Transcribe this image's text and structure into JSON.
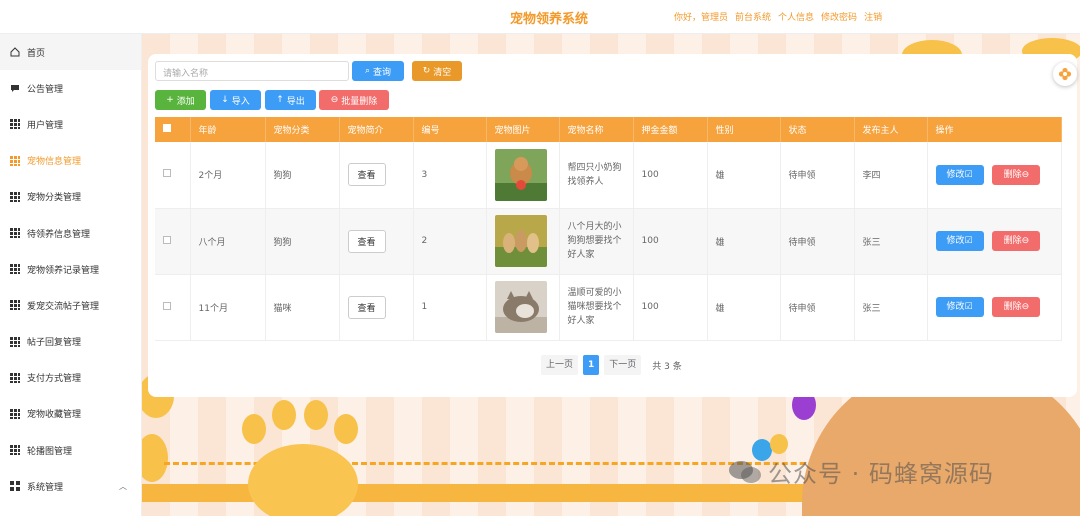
{
  "header": {
    "title": "宠物领养系统",
    "links": [
      "你好，管理员",
      "前台系统",
      "个人信息",
      "修改密码",
      "注销"
    ]
  },
  "sidebar": {
    "items": [
      {
        "label": "首页",
        "icon": "home-icon"
      },
      {
        "label": "公告管理",
        "icon": "message-icon"
      },
      {
        "label": "用户管理",
        "icon": "grid-icon"
      },
      {
        "label": "宠物信息管理",
        "icon": "grid-icon"
      },
      {
        "label": "宠物分类管理",
        "icon": "grid-icon"
      },
      {
        "label": "待领养信息管理",
        "icon": "grid-icon"
      },
      {
        "label": "宠物领养记录管理",
        "icon": "grid-icon"
      },
      {
        "label": "爱宠交流帖子管理",
        "icon": "grid-icon"
      },
      {
        "label": "帖子回复管理",
        "icon": "grid-icon"
      },
      {
        "label": "支付方式管理",
        "icon": "grid-icon"
      },
      {
        "label": "宠物收藏管理",
        "icon": "grid-icon"
      },
      {
        "label": "轮播图管理",
        "icon": "grid-icon"
      },
      {
        "label": "系统管理",
        "icon": "apps-icon"
      }
    ],
    "active_index": 3
  },
  "toolbar": {
    "search_placeholder": "请输入名称",
    "query_label": "查询",
    "clear_label": "清空",
    "add_label": "添加",
    "import_label": "导入",
    "export_label": "导出",
    "batch_delete_label": "批量删除"
  },
  "table": {
    "headers": [
      "",
      "年龄",
      "宠物分类",
      "宠物简介",
      "编号",
      "宠物图片",
      "宠物名称",
      "押金金额",
      "性别",
      "状态",
      "发布主人",
      "操作"
    ],
    "view_label": "查看",
    "edit_label": "修改",
    "delete_label": "删除",
    "rows": [
      {
        "age": "2个月",
        "category": "狗狗",
        "id": "3",
        "name": "帮四只小奶狗找领养人",
        "deposit": "100",
        "gender": "雄",
        "status": "待申领",
        "owner": "李四"
      },
      {
        "age": "八个月",
        "category": "狗狗",
        "id": "2",
        "name": "八个月大的小狗狗想要找个好人家",
        "deposit": "100",
        "gender": "雄",
        "status": "待申领",
        "owner": "张三"
      },
      {
        "age": "11个月",
        "category": "猫咪",
        "id": "1",
        "name": "温顺可爱的小猫咪想要找个好人家",
        "deposit": "100",
        "gender": "雄",
        "status": "待申领",
        "owner": "张三"
      }
    ]
  },
  "pagination": {
    "prev": "上一页",
    "current": "1",
    "next": "下一页",
    "total": "共 3 条"
  },
  "watermark": "公众号 · 码蜂窝源码",
  "colors": {
    "accent": "#f6a23d",
    "blue": "#3d9cf5",
    "red": "#f36c6c",
    "green": "#59b43e"
  }
}
